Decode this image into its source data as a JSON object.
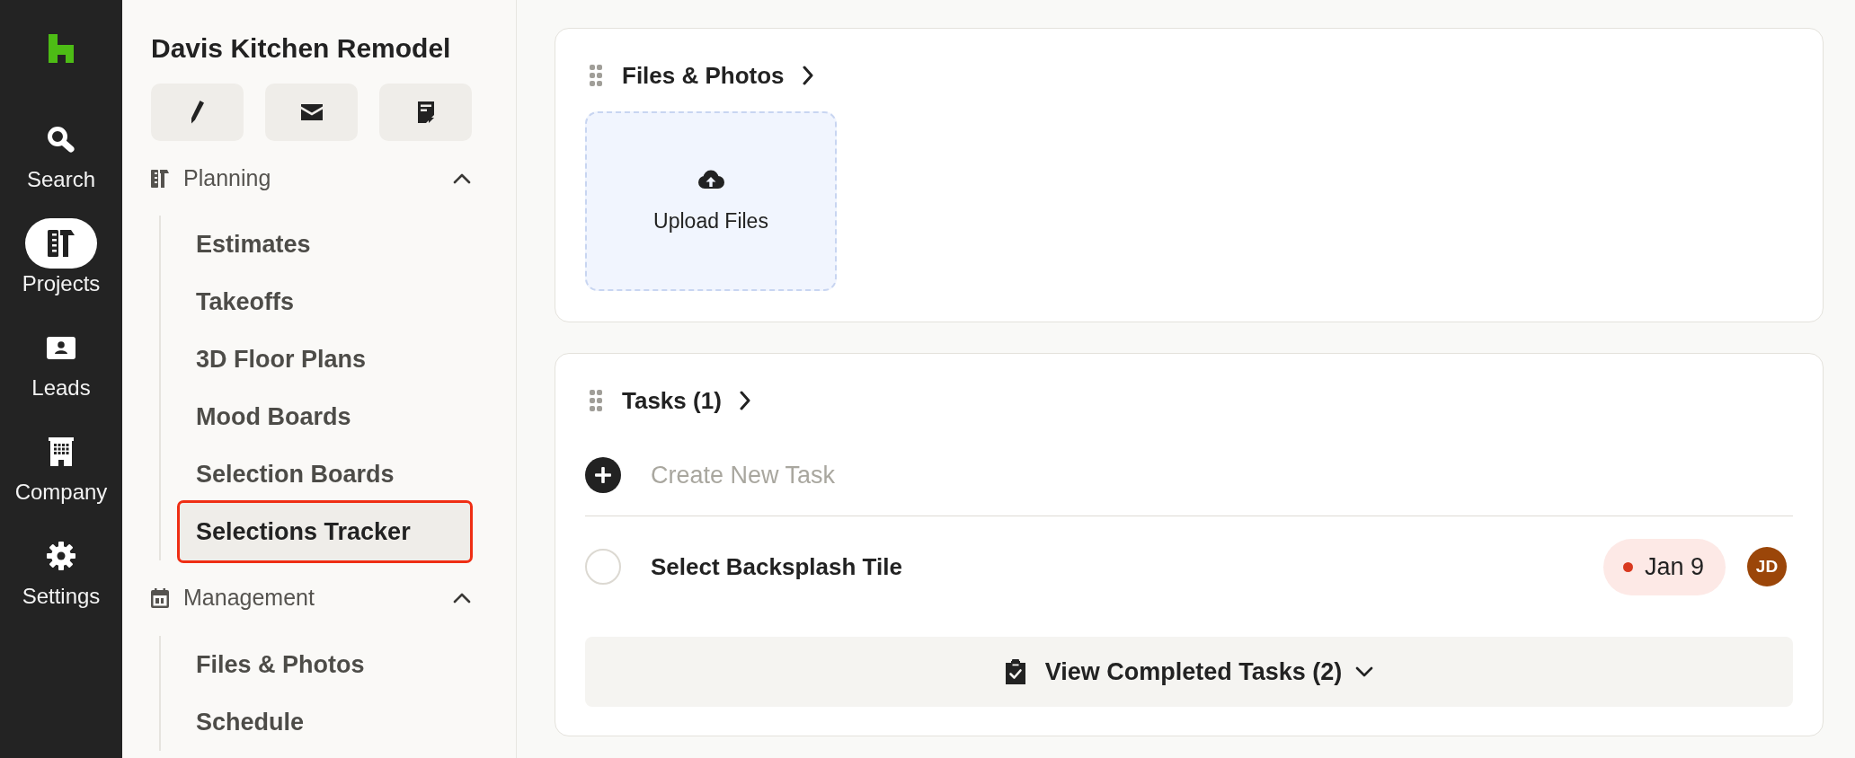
{
  "rail": {
    "items": [
      {
        "label": "Search",
        "selected": false
      },
      {
        "label": "Projects",
        "selected": true
      },
      {
        "label": "Leads",
        "selected": false
      },
      {
        "label": "Company",
        "selected": false
      },
      {
        "label": "Settings",
        "selected": false
      }
    ]
  },
  "sidebar": {
    "title": "Davis Kitchen Remodel",
    "sections": [
      {
        "label": "Planning",
        "expanded": true,
        "items": [
          {
            "label": "Estimates",
            "selected": false,
            "highlighted": false
          },
          {
            "label": "Takeoffs",
            "selected": false,
            "highlighted": false
          },
          {
            "label": "3D Floor Plans",
            "selected": false,
            "highlighted": false
          },
          {
            "label": "Mood Boards",
            "selected": false,
            "highlighted": false
          },
          {
            "label": "Selection Boards",
            "selected": false,
            "highlighted": false
          },
          {
            "label": "Selections Tracker",
            "selected": true,
            "highlighted": true
          }
        ]
      },
      {
        "label": "Management",
        "expanded": true,
        "items": [
          {
            "label": "Files & Photos",
            "selected": false,
            "highlighted": false
          },
          {
            "label": "Schedule",
            "selected": false,
            "highlighted": false
          }
        ]
      }
    ]
  },
  "files_card": {
    "title": "Files & Photos",
    "upload_label": "Upload Files"
  },
  "tasks_card": {
    "title": "Tasks (1)",
    "new_task": {
      "placeholder": "Create New Task"
    },
    "tasks": [
      {
        "title": "Select Backsplash Tile",
        "checked": false,
        "due": "Jan 9",
        "overdue": true,
        "assignee": {
          "initials": "JD",
          "color": "#9b4609"
        }
      }
    ],
    "completed": {
      "label": "View Completed Tasks (2)",
      "expanded": false
    }
  }
}
